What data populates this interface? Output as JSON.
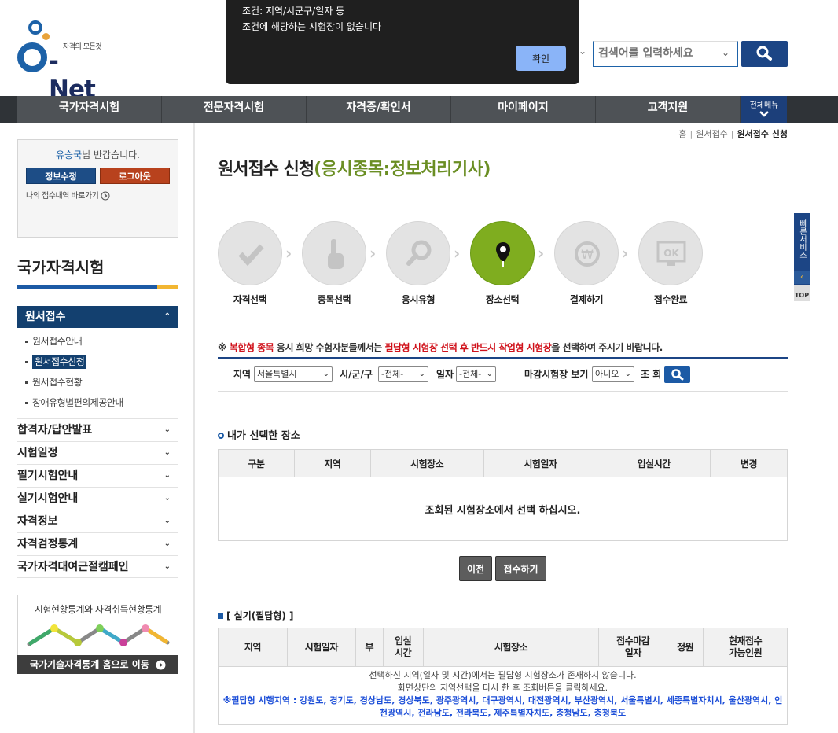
{
  "header": {
    "logo_tagline": "자격의 모든것",
    "logo_text": "Net",
    "search_placeholder": "검색어를 입력하세요"
  },
  "gnb": {
    "items": [
      "국가자격시험",
      "전문자격시험",
      "자격증/확인서",
      "마이페이지",
      "고객지원"
    ],
    "all_menu": "전체메뉴"
  },
  "alert": {
    "line1": "조건: 지역/시군구/일자 등",
    "line2": "조건에 해당하는 시험장이 없습니다",
    "ok_label": "확인"
  },
  "login": {
    "user_name": "유승국",
    "greeting_suffix": "님 반갑습니다.",
    "edit_label": "정보수정",
    "logout_label": "로그아웃",
    "my_link": "나의 접수내역 바로가기"
  },
  "sidebar": {
    "title": "국가자격시험",
    "active_menu": "원서접수",
    "sub_items": [
      "원서접수안내",
      "원서접수신청",
      "원서접수현황",
      "장애유형별편의제공안내"
    ],
    "menus": [
      "합격자/답안발표",
      "시험일정",
      "필기시험안내",
      "실기시험안내",
      "자격정보",
      "자격검정통계",
      "국가자격대여근절캠페인"
    ],
    "stat_title": "시험현황통계와 자격취득현황통계",
    "stat_link": "국가기술자격통계 홈으로 이동"
  },
  "breadcrumb": {
    "home": "홈",
    "level1": "원서접수",
    "current": "원서접수 신청"
  },
  "page": {
    "title": "원서접수 신청",
    "subtitle": "(응시종목:정보처리기사)"
  },
  "steps": [
    "자격선택",
    "종목선택",
    "응시유형",
    "장소선택",
    "결제하기",
    "접수완료"
  ],
  "notice": {
    "mark": "※",
    "part1": "복합형 종목",
    "part2": " 응시 희망 수험자분들께서는 ",
    "part3": "필답형 시험장 선택 후 반드시 작업형 시험장",
    "part4": "을 선택하여 주시기 바랍니다."
  },
  "filter": {
    "region_label": "지역",
    "region_value": "서울특별시",
    "district_label": "시/군/구",
    "district_value": "-전체-",
    "date_label": "일자",
    "date_value": "-전체-",
    "closed_label": "마감시험장 보기",
    "closed_value": "아니오",
    "query_label": "조 회"
  },
  "my_place": {
    "title": "내가 선택한 장소",
    "headers": [
      "구분",
      "지역",
      "시험장소",
      "시험일자",
      "입실시간",
      "변경"
    ],
    "empty": "조회된 시험장소에서 선택 하십시오."
  },
  "buttons": {
    "prev": "이전",
    "submit": "접수하기"
  },
  "practical": {
    "title": "[ 실기(필답형) ]",
    "headers": [
      "지역",
      "시험일자",
      "부",
      "입실\n시간",
      "시험장소",
      "접수마감\n일자",
      "정원",
      "현재접수\n가능인원"
    ],
    "msg1": "선택하신 지역(일자 및 시간)에서는 필답형 시험장소가 존재하지 않습니다.",
    "msg2": "화면상단의 지역선택을 다시 한 후 조회버튼을 클릭하세요.",
    "msg3": "※필답형 시행지역 : 강원도, 경기도, 경상남도, 경상북도, 광주광역시, 대구광역시, 대전광역시, 부산광역시, 서울특별시, 세종특별자치시, 울산광역시, 인천광역시, 전라남도, 전라북도, 제주특별자치도, 충청남도, 충청북도"
  },
  "quick": {
    "label": "빠른서비스",
    "top": "TOP"
  },
  "colors": {
    "brand_blue": "#1c4585",
    "accent_green": "#7fad1f",
    "alert_red": "#d0121b"
  }
}
